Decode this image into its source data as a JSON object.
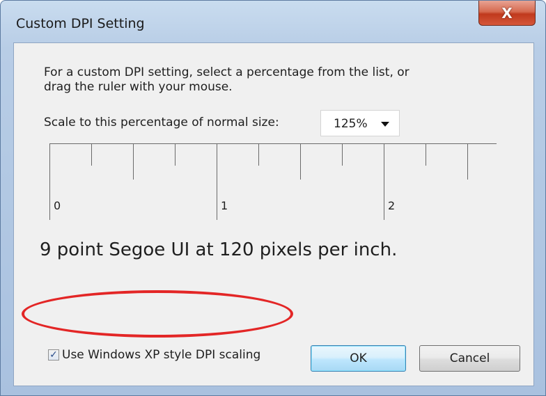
{
  "window": {
    "title": "Custom DPI Setting",
    "close_label": "X"
  },
  "dialog": {
    "description_line1": "For a custom DPI setting, select a percentage from the list, or",
    "description_line2": "drag the ruler with your mouse.",
    "scale_label": "Scale to this percentage of normal size:",
    "scale_selected": "125%",
    "ruler_labels": [
      "0",
      "1",
      "2"
    ],
    "sample_text": "9 point Segoe UI at 120 pixels per inch.",
    "xp_scaling_label": "Use Windows XP style DPI scaling",
    "xp_scaling_checked": true,
    "ok_label": "OK",
    "cancel_label": "Cancel"
  },
  "colors": {
    "annotation_highlight": "#e32626",
    "default_button_border": "#3c7fb1",
    "close_button": "#c0391d"
  }
}
